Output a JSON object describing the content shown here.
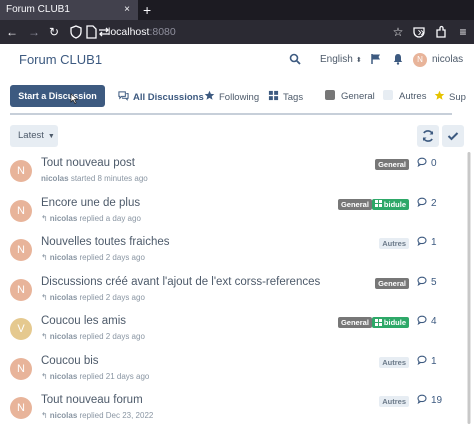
{
  "browser": {
    "tab_title": "Forum CLUB1",
    "tab_close": "×",
    "new_tab": "+",
    "url_host": "localhost",
    "url_port": ":8080"
  },
  "header": {
    "brand": "Forum CLUB1",
    "language": "English",
    "username": "nicolas",
    "avatar_letter": "N"
  },
  "hero": {
    "start_button": "Start a Discussion",
    "tabs": [
      {
        "label": "All Discussions",
        "icon": "comments-icon"
      },
      {
        "label": "Following",
        "icon": "star-icon"
      },
      {
        "label": "Tags",
        "icon": "tags-grid-icon"
      },
      {
        "label": "General",
        "color": "#777777"
      },
      {
        "label": "Autres",
        "color": "#e7edf3"
      },
      {
        "label": "Sup",
        "icon": "star-icon",
        "color": "#e6c300"
      }
    ]
  },
  "toolbar": {
    "sort_label": "Latest"
  },
  "discussions": [
    {
      "avatar": "N",
      "avatar_color": "#e8b49a",
      "title": "Tout nouveau post",
      "author": "nicolas",
      "action": "started 8 minutes ago",
      "reply_icon": false,
      "tags": [
        "General"
      ],
      "count": "0"
    },
    {
      "avatar": "N",
      "avatar_color": "#e8b49a",
      "title": "Encore une de plus",
      "author": "nicolas",
      "action": "replied a day ago",
      "reply_icon": true,
      "tags": [
        "General",
        "bidule"
      ],
      "count": "2"
    },
    {
      "avatar": "N",
      "avatar_color": "#e8b49a",
      "title": "Nouvelles toutes fraiches",
      "author": "nicolas",
      "action": "replied 2 days ago",
      "reply_icon": true,
      "tags": [
        "Autres"
      ],
      "count": "1"
    },
    {
      "avatar": "N",
      "avatar_color": "#e8b49a",
      "title": "Discussions créé avant l'ajout de l'ext corss-references",
      "author": "nicolas",
      "action": "replied 2 days ago",
      "reply_icon": true,
      "tags": [
        "General"
      ],
      "count": "5"
    },
    {
      "avatar": "V",
      "avatar_color": "#e5c98f",
      "title": "Coucou les amis",
      "author": "nicolas",
      "action": "replied 2 days ago",
      "reply_icon": true,
      "tags": [
        "General",
        "bidule"
      ],
      "count": "4"
    },
    {
      "avatar": "N",
      "avatar_color": "#e8b49a",
      "title": "Coucou bis",
      "author": "nicolas",
      "action": "replied 21 days ago",
      "reply_icon": true,
      "tags": [
        "Autres"
      ],
      "count": "1"
    },
    {
      "avatar": "N",
      "avatar_color": "#e8b49a",
      "title": "Tout nouveau forum",
      "author": "nicolas",
      "action": "replied Dec 23, 2022",
      "reply_icon": true,
      "tags": [
        "Autres"
      ],
      "count": "19"
    }
  ]
}
